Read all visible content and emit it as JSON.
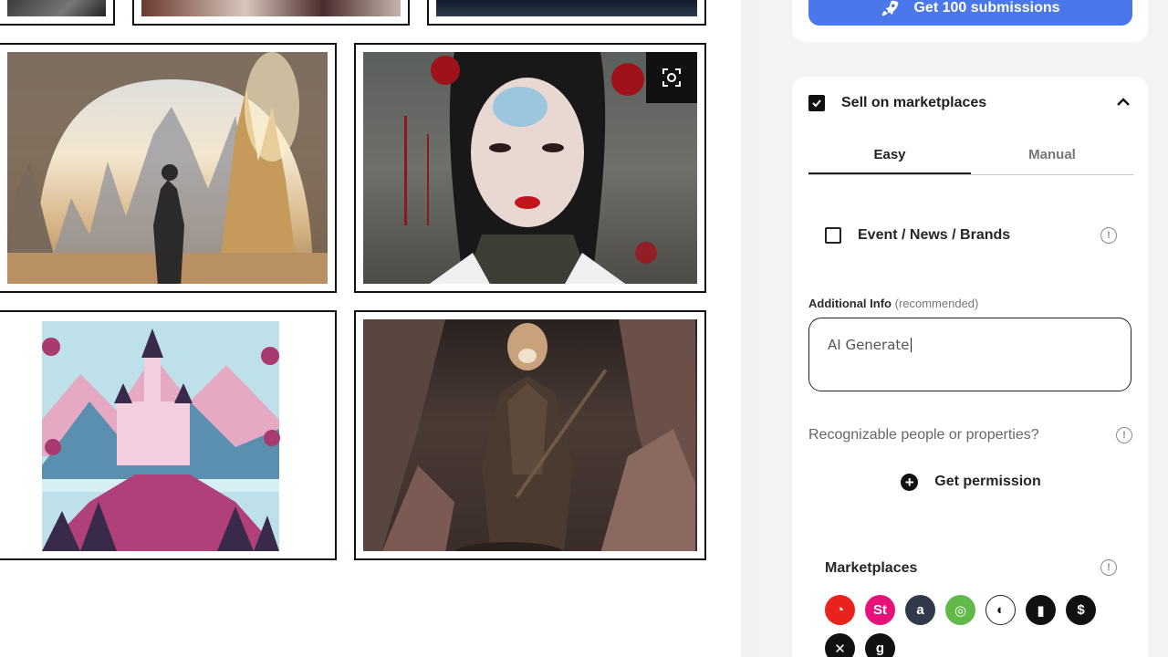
{
  "panel": {
    "submissions_button": "Get 100 submissions",
    "sell": {
      "label": "Sell on marketplaces",
      "checked": true
    },
    "tabs": [
      {
        "label": "Easy",
        "active": true
      },
      {
        "label": "Manual",
        "active": false
      }
    ],
    "event": {
      "label": "Event / News / Brands",
      "checked": false
    },
    "additional_info": {
      "label": "Additional Info",
      "hint": "(recommended)",
      "value": "AI Generate"
    },
    "recognizable": "Recognizable people or properties?",
    "permission_button": "Get permission",
    "marketplaces": {
      "title": "Marketplaces",
      "icons": [
        {
          "name": "shutterstock-icon",
          "color": "#e8231b",
          "glyph": "◔"
        },
        {
          "name": "adobe-stock-icon",
          "color": "#e6127a",
          "glyph": "St"
        },
        {
          "name": "alamy-icon",
          "color": "#303a4a",
          "glyph": "a"
        },
        {
          "name": "dreamstime-icon",
          "color": "#61b94a",
          "glyph": "◎"
        },
        {
          "name": "vecteezy-icon",
          "color": "#ffffff",
          "glyph": "◐"
        },
        {
          "name": "istock-icon",
          "color": "#111111",
          "glyph": "▮"
        },
        {
          "name": "pond5-icon",
          "color": "#111111",
          "glyph": "$"
        },
        {
          "name": "123rf-icon",
          "color": "#111111",
          "glyph": "✕"
        },
        {
          "name": "getty-icon",
          "color": "#111111",
          "glyph": "g"
        }
      ]
    }
  },
  "colors": {
    "accent": "#4a78ea",
    "panel_bg": "#f3f3f4",
    "text": "#1f1f1f"
  }
}
